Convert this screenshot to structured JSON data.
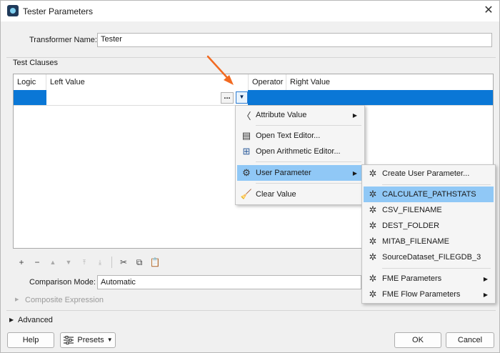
{
  "window": {
    "title": "Tester Parameters",
    "close_glyph": "✕"
  },
  "transformer": {
    "label": "Transformer Name:",
    "value": "Tester"
  },
  "test_clauses": {
    "label": "Test Clauses",
    "columns": [
      "Logic",
      "Left Value",
      "Operator",
      "Right Value"
    ],
    "ellipsis_button": "...",
    "dropdown_glyph": "▼"
  },
  "context_menu": {
    "items": [
      {
        "icon": "attribute-value-icon",
        "label": "Attribute Value",
        "submenu": true
      },
      {
        "icon": "text-editor-icon",
        "label": "Open Text Editor..."
      },
      {
        "icon": "arithmetic-editor-icon",
        "label": "Open Arithmetic Editor..."
      },
      {
        "icon": "user-parameter-icon",
        "label": "User Parameter",
        "submenu": true,
        "highlighted": true
      },
      {
        "icon": "clear-value-icon",
        "label": "Clear Value"
      }
    ]
  },
  "submenu": {
    "items": [
      {
        "icon": "create-parameter-icon",
        "label": "Create User Parameter..."
      },
      {
        "icon": "parameter-icon",
        "label": "CALCULATE_PATHSTATS",
        "highlighted": true
      },
      {
        "icon": "parameter-icon",
        "label": "CSV_FILENAME"
      },
      {
        "icon": "parameter-icon",
        "label": "DEST_FOLDER"
      },
      {
        "icon": "parameter-icon",
        "label": "MITAB_FILENAME"
      },
      {
        "icon": "parameter-icon",
        "label": "SourceDataset_FILEGDB_3"
      },
      {
        "icon": "fme-parameters-icon",
        "label": "FME Parameters",
        "submenu": true
      },
      {
        "icon": "fme-flow-parameters-icon",
        "label": "FME Flow Parameters",
        "submenu": true
      }
    ]
  },
  "comparison": {
    "label": "Comparison Mode:",
    "value": "Automatic"
  },
  "composite": {
    "label": "Composite Expression"
  },
  "advanced": {
    "label": "Advanced"
  },
  "buttons": {
    "help": "Help",
    "presets": "Presets",
    "ok": "OK",
    "cancel": "Cancel"
  },
  "colors": {
    "selection": "#0a77d6",
    "menu_highlight": "#90c8f6",
    "annotation_arrow": "#f26a21"
  }
}
